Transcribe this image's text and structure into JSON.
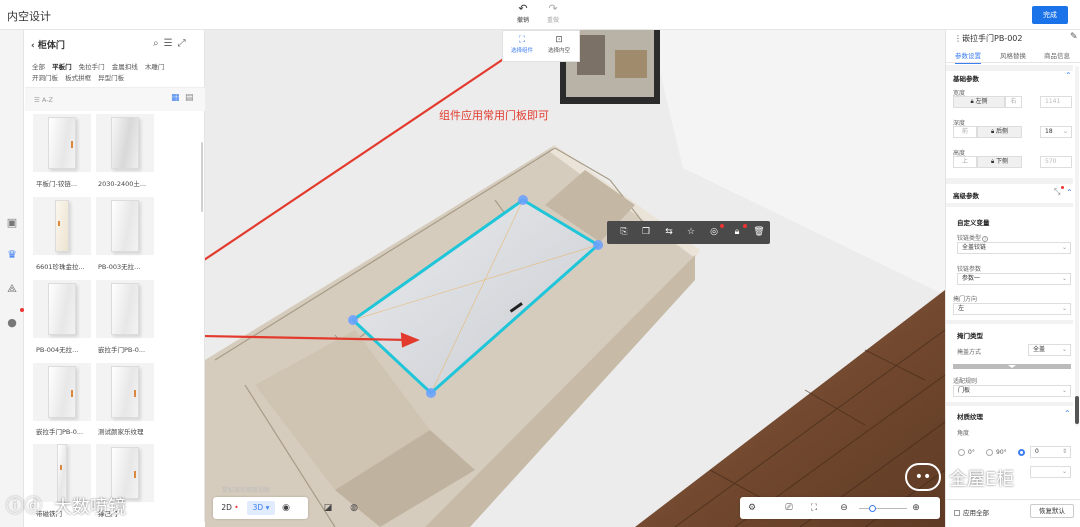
{
  "app": {
    "title": "内空设计",
    "done_label": "完成"
  },
  "history": {
    "undo_label": "撤销",
    "redo_label": "重做"
  },
  "leftnav": {
    "icons": [
      "cabinet-icon",
      "crown-icon",
      "layers-icon",
      "user-icon"
    ]
  },
  "panel": {
    "title": "柜体门",
    "filter_row1": [
      "全部",
      "平板门",
      "免拉手门",
      "金属扣线",
      "木雕门"
    ],
    "filter_row2": [
      "开洞门板",
      "板式拼框",
      "异型门板"
    ],
    "selected_filter": "平板门",
    "sort_label": "A-Z",
    "items": [
      {
        "label": "平板门-铰链..."
      },
      {
        "label": "2030-2400土..."
      },
      {
        "label": "6601珍珠金拉..."
      },
      {
        "label": "PB-003无拉..."
      },
      {
        "label": "PB-004无拉..."
      },
      {
        "label": "嵌拉手门PB-0..."
      },
      {
        "label": "嵌拉手门PB-0..."
      },
      {
        "label": "测试颜家乐纹理"
      },
      {
        "label": "带磁铁门"
      },
      {
        "label": "撑已门"
      }
    ]
  },
  "viewport": {
    "select_tool": {
      "component_label": "选择组件",
      "inner_label": "选择内空"
    },
    "annotation": "组件应用常用门板即可",
    "hint": "鼠标滚轮缩放视图",
    "view_2d": "2D",
    "view_3d": "3D",
    "float_toolbar_icons": [
      "copy-icon",
      "duplicate-icon",
      "mirror-icon",
      "star-icon",
      "hide-icon",
      "lock-icon",
      "delete-icon"
    ]
  },
  "right": {
    "title": "嵌拉手门PB-002",
    "tabs": [
      "参数设置",
      "风格替换",
      "商品信息"
    ],
    "basic_title": "基础参数",
    "width_label": "宽度",
    "width_left": "左侧",
    "width_right": "右",
    "width_value": "1141",
    "depth_label": "深度",
    "depth_front": "前",
    "depth_back": "后侧",
    "depth_value": "18",
    "height_label": "高度",
    "height_up": "上",
    "height_down": "下侧",
    "height_value": "570",
    "advanced_title": "高级参数",
    "custom_vars_title": "自定义变量",
    "hinge_type_label": "铰链类型",
    "hinge_type_value": "全盖铰链",
    "hinge_param_label": "铰链参数",
    "hinge_param_value": "参数一",
    "open_dir_label": "掩门方向",
    "open_dir_value": "左",
    "door_type_title": "掩门类型",
    "cover_mode_label": "掩盖方式",
    "cover_mode_value": "全盖",
    "fit_rule_label": "适配规则",
    "fit_rule_value": "门板",
    "texture_title": "材质纹理",
    "angle_label": "角度",
    "angle_options": [
      "0°",
      "90°"
    ],
    "angle_value": "0",
    "apply_all": "应用全部",
    "restore_default": "恢复默认"
  },
  "watermarks": {
    "brand_right": "全屋E柜",
    "brand_left": "大数喷镜"
  },
  "colors": {
    "accent": "#3d7ff0",
    "annotation": "#e23b2e",
    "selection": "#1fc5d8"
  }
}
